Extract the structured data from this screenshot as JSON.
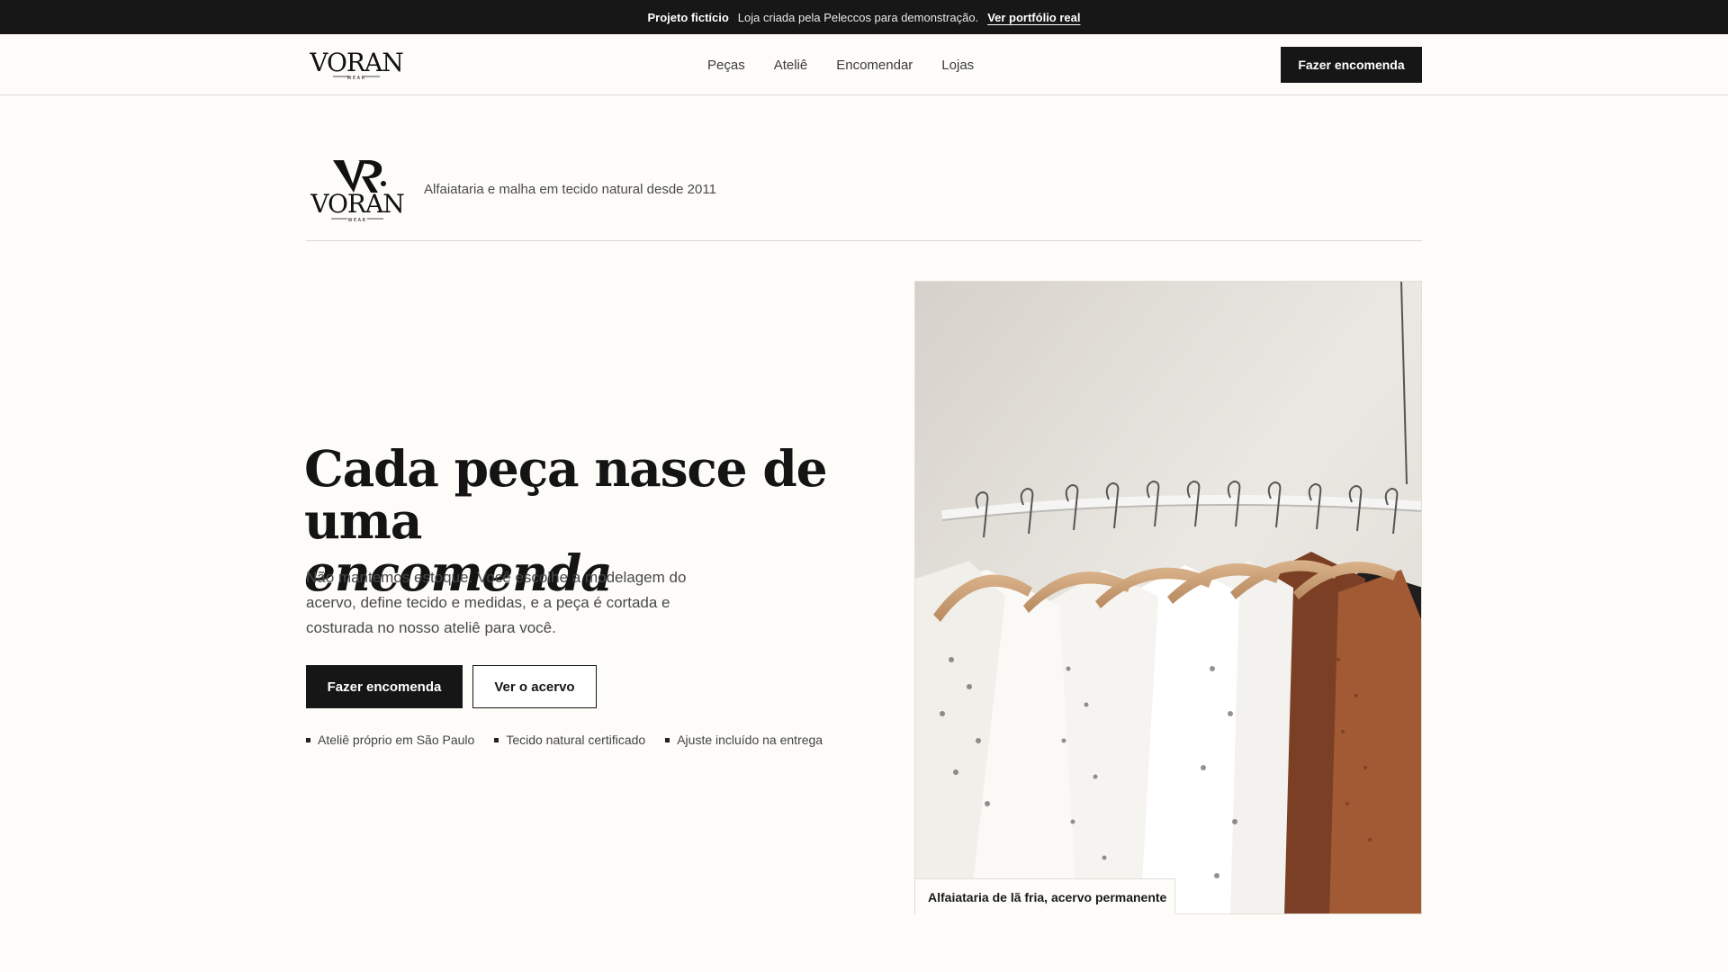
{
  "announcement": {
    "label": "Projeto fictício",
    "text": "Loja criada pela Peleccos para demonstração.",
    "link": "Ver portfólio real"
  },
  "header": {
    "logo_alt": "VORAN WEAR",
    "nav": [
      "Peças",
      "Ateliê",
      "Encomendar",
      "Lojas"
    ],
    "cta": "Fazer encomenda"
  },
  "brand": {
    "logo_alt": "VR VORAN WEAR",
    "tagline": "Alfaiataria e malha em tecido natural desde 2011"
  },
  "hero": {
    "title_line1": "Cada peça nasce de uma",
    "title_line2": "encomenda",
    "subtitle": "Não mantemos estoque. Você escolhe a modelagem do acervo, define tecido e medidas, e a peça é cortada e costurada no nosso ateliê para você.",
    "cta_primary": "Fazer encomenda",
    "cta_secondary": "Ver o acervo",
    "features": [
      "Ateliê próprio em São Paulo",
      "Tecido natural certificado",
      "Ajuste incluído na entrega"
    ],
    "image_caption": "Alfaiataria de lã fria, acervo permanente"
  },
  "colors": {
    "background": "#fdfcf9",
    "dark": "#161616",
    "text_muted": "#4a4a4a"
  }
}
